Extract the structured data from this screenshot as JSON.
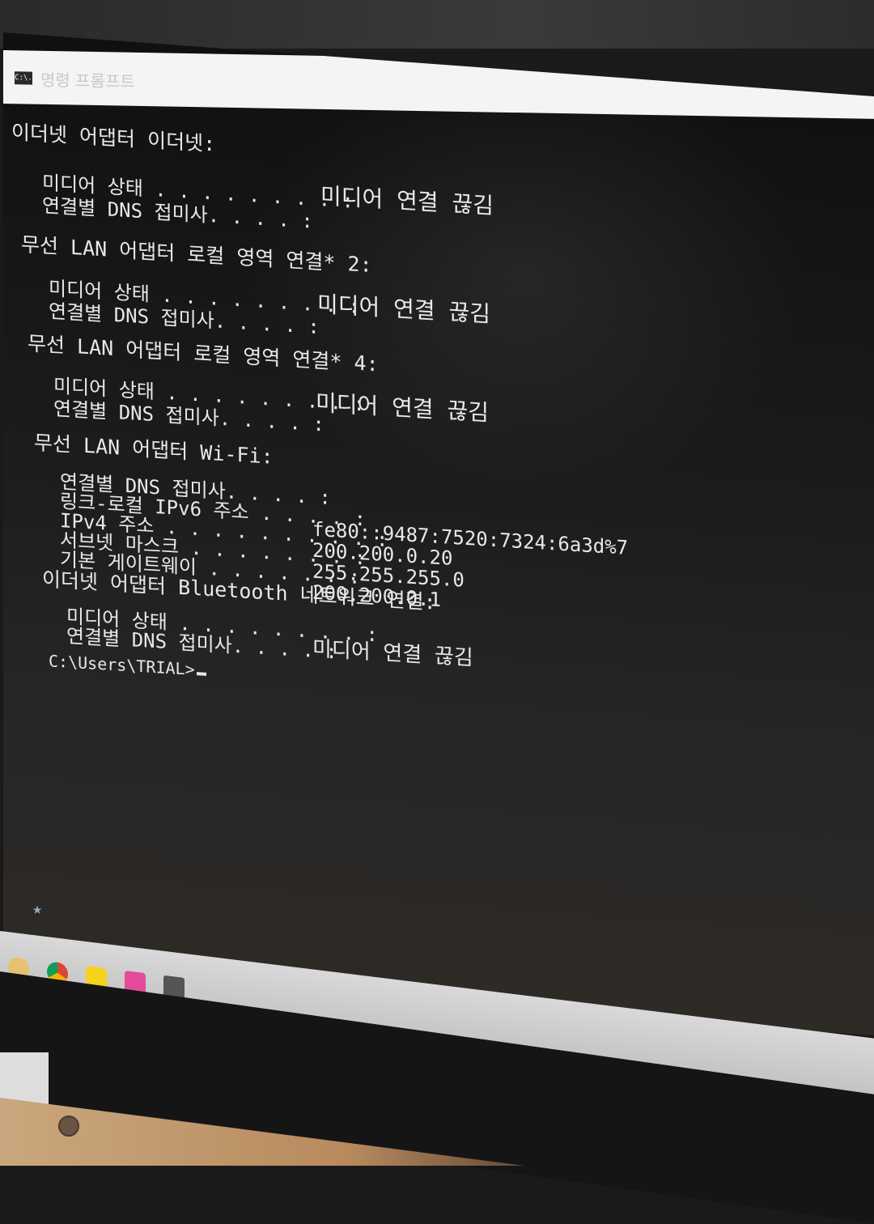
{
  "window": {
    "title": "명령 프롬프트",
    "icon_label": "C:\\."
  },
  "console": {
    "sections": [
      {
        "header": "이더넷 어댑터 이더넷:",
        "rows": [
          {
            "label": "미디어 상태 . . . . . . . . :",
            "value": "미디어 연결 끊김"
          },
          {
            "label": "연결별 DNS 접미사. . . . :",
            "value": ""
          }
        ]
      },
      {
        "header": "무선 LAN 어댑터 로컬 영역 연결* 2:",
        "rows": [
          {
            "label": "미디어 상태 . . . . . . . . :",
            "value": "미디어 연결 끊김"
          },
          {
            "label": "연결별 DNS 접미사. . . . :",
            "value": ""
          }
        ]
      },
      {
        "header": "무선 LAN 어댑터 로컬 영역 연결* 4:",
        "rows": [
          {
            "label": "미디어 상태 . . . . . . . . :",
            "value": "미디어 연결 끊김"
          },
          {
            "label": "연결별 DNS 접미사. . . . :",
            "value": ""
          }
        ]
      },
      {
        "header": "무선 LAN 어댑터 Wi-Fi:",
        "rows": [
          {
            "label": "연결별 DNS 접미사. . . . :",
            "value": ""
          },
          {
            "label": "링크-로컬 IPv6 주소 . . . . :",
            "value": "fe80::9487:7520:7324:6a3d%7"
          },
          {
            "label": "IPv4 주소 . . . . . . . . . :",
            "value": "200.200.0.20"
          },
          {
            "label": "서브넷 마스크 . . . . . . . :",
            "value": "255.255.255.0"
          },
          {
            "label": "기본 게이트웨이 . . . . . . :",
            "value": "200.200.0.1"
          }
        ]
      },
      {
        "header": "이더넷 어댑터 Bluetooth 네트워크 연결:",
        "rows": [
          {
            "label": "미디어 상태 . . . . . . . . :",
            "value": "미디어 연결 끊김"
          },
          {
            "label": "연결별 DNS 접미사. . . . :",
            "value": ""
          }
        ]
      }
    ],
    "prompt": "C:\\Users\\TRIAL>"
  },
  "taskbar": {
    "icons": [
      "file-explorer-icon",
      "chrome-icon",
      "kakaotalk-icon",
      "app-icon",
      "photos-icon"
    ]
  }
}
